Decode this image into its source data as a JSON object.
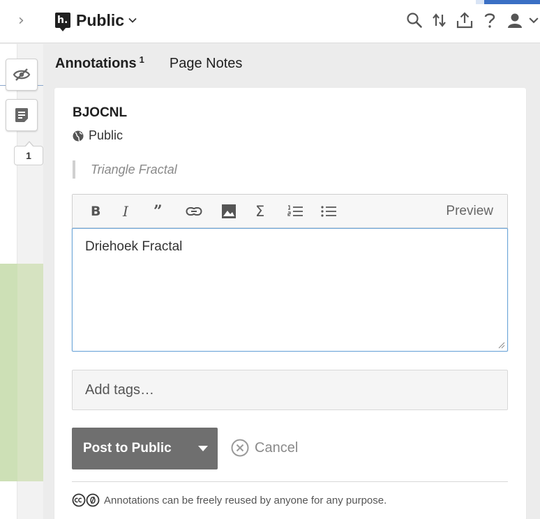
{
  "header": {
    "group_name": "Public",
    "icons": [
      "search-icon",
      "sort-icon",
      "share-icon",
      "help-icon",
      "user-icon",
      "chevron-down-icon"
    ]
  },
  "sidebar": {
    "annotation_count": "1",
    "icons": [
      "hide-highlights-icon",
      "page-notes-icon"
    ]
  },
  "tabs": {
    "annotations_label": "Annotations",
    "annotations_count": "1",
    "page_notes_label": "Page Notes"
  },
  "annotation": {
    "user": "BJOCNL",
    "privacy": "Public",
    "quote": "Triangle Fractal",
    "body_text": "Driehoek Fractal",
    "tags_placeholder": "Add tags…",
    "toolbar": {
      "bold": "B",
      "italic": "I",
      "quote": "”",
      "math": "Σ",
      "preview": "Preview"
    },
    "post_label": "Post to Public",
    "cancel_label": "Cancel",
    "license_text": "Annotations can be freely reused by anyone for any purpose."
  },
  "colors": {
    "accent_blue": "#3a6fc4",
    "focus_border": "#6ea6d9",
    "post_button": "#6f6f6f",
    "highlight_green": "#d6e3c1"
  }
}
